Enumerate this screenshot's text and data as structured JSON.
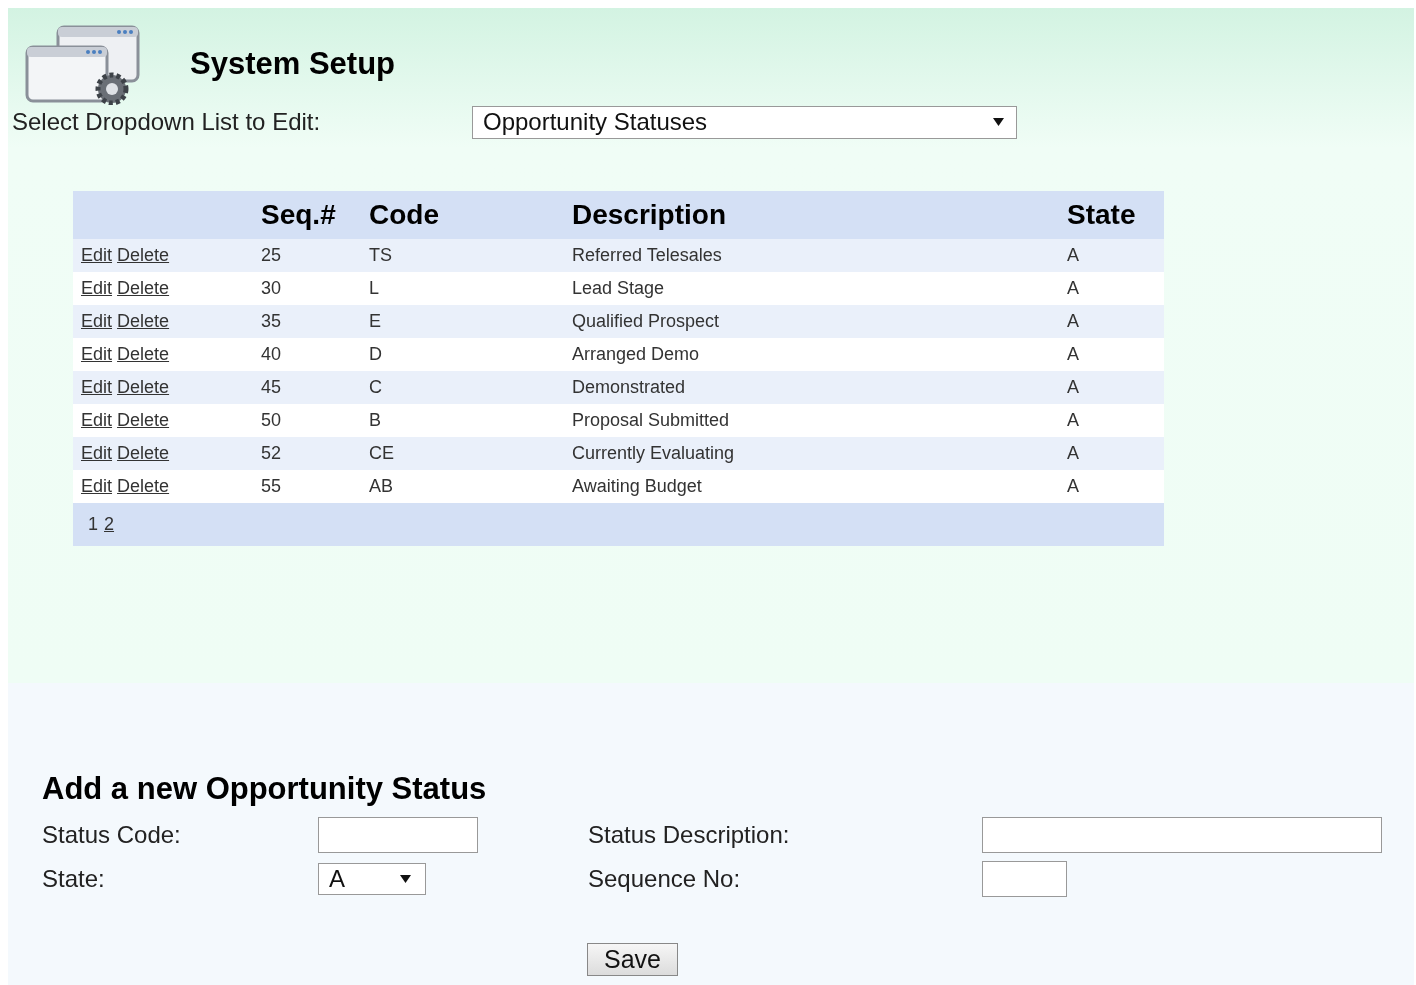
{
  "header": {
    "title": "System Setup"
  },
  "list_picker": {
    "label": "Select Dropdown List to Edit:",
    "value": "Opportunity Statuses"
  },
  "table": {
    "columns": [
      "",
      "Seq.#",
      "Code",
      "Description",
      "State"
    ],
    "rows": [
      {
        "edit": "Edit",
        "delete": "Delete",
        "seq": "25",
        "code": "TS",
        "description": "Referred Telesales",
        "state": "A"
      },
      {
        "edit": "Edit",
        "delete": "Delete",
        "seq": "30",
        "code": "L",
        "description": "Lead Stage",
        "state": "A"
      },
      {
        "edit": "Edit",
        "delete": "Delete",
        "seq": "35",
        "code": "E",
        "description": "Qualified Prospect",
        "state": "A"
      },
      {
        "edit": "Edit",
        "delete": "Delete",
        "seq": "40",
        "code": "D",
        "description": "Arranged Demo",
        "state": "A"
      },
      {
        "edit": "Edit",
        "delete": "Delete",
        "seq": "45",
        "code": "C",
        "description": "Demonstrated",
        "state": "A"
      },
      {
        "edit": "Edit",
        "delete": "Delete",
        "seq": "50",
        "code": "B",
        "description": "Proposal Submitted",
        "state": "A"
      },
      {
        "edit": "Edit",
        "delete": "Delete",
        "seq": "52",
        "code": "CE",
        "description": "Currently Evaluating",
        "state": "A"
      },
      {
        "edit": "Edit",
        "delete": "Delete",
        "seq": "55",
        "code": "AB",
        "description": "Awaiting Budget",
        "state": "A"
      }
    ],
    "pages": [
      {
        "label": "1",
        "selected": true
      },
      {
        "label": "2",
        "selected": false
      }
    ]
  },
  "form": {
    "title": "Add a new Opportunity Status",
    "status_code": {
      "label": "Status Code:"
    },
    "status_description": {
      "label": "Status Description:"
    },
    "state": {
      "label": "State:",
      "value": "A"
    },
    "sequence_no": {
      "label": "Sequence No:"
    },
    "save": "Save"
  }
}
